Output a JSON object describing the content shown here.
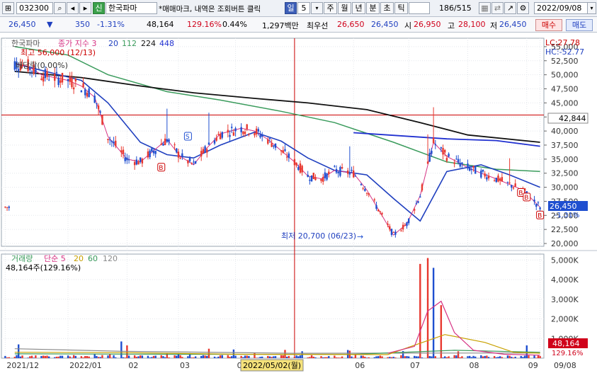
{
  "toolbar": {
    "code": "032300",
    "name_badge": "신",
    "name": "한국파마",
    "marquee": "*매매마크, 내역은 조회버튼 클릭",
    "period_unit": "일",
    "period_value": "5",
    "periods": [
      "주",
      "월",
      "년",
      "분",
      "초",
      "틱"
    ],
    "bars_count": "186/515",
    "date": "2022/09/08",
    "count_value": "350"
  },
  "quote": {
    "price": "26,450",
    "arrow": "▼",
    "change": "350",
    "change_pct": "-1.31%",
    "volume": "48,164",
    "volume_pct": "129.16%",
    "turnover_pct": "0.44%",
    "amount": "1,297백만",
    "best_ask_label": "최우선",
    "best_ask": "26,650",
    "best_bid": "26,450",
    "open_label": "시",
    "open": "26,950",
    "high_label": "고",
    "high": "28,100",
    "low_label": "저",
    "low": "26,450",
    "buy_label": "매수",
    "sell_label": "매도"
  },
  "colors": {
    "up": "#e8382f",
    "down": "#1f4fd0",
    "ma3": "#d63384",
    "ma20": "#1f3fbf",
    "ma112": "#3a9b5c",
    "ma224": "#111111",
    "ma448": "#2030d0",
    "accent_red": "#cc0000"
  },
  "chart_data": [
    {
      "type": "candlestick",
      "title": "한국파마",
      "legend": [
        {
          "label": "종가 지수 3",
          "color": "#d63384"
        },
        {
          "label": "20",
          "color": "#1f3fbf"
        },
        {
          "label": "112",
          "color": "#3a9b5c"
        },
        {
          "label": "224",
          "color": "#111111"
        },
        {
          "label": "448",
          "color": "#2030d0"
        }
      ],
      "annotations": {
        "high": "최고 56,000 (12/13)",
        "low": "최저 20,700 (06/23)",
        "pattern": "배당락(0.00%)",
        "lc": "LC:27.78",
        "hc": "HC:-52.77",
        "marker_price": "42,844",
        "cursor_date": "2022/05/02(월)",
        "last_price_tag": "26,450",
        "last_pct_tag": "-1.31%",
        "trade_marks": [
          "S",
          "B",
          "B",
          "B",
          "B"
        ]
      },
      "ylim": [
        19500,
        56500
      ],
      "y_ticks": [
        20000,
        22500,
        25000,
        27500,
        30000,
        32500,
        35000,
        37500,
        40000,
        42500,
        45000,
        47500,
        50000,
        52500,
        55000
      ],
      "y_tick_labels": [
        "20,000",
        "22,500",
        "25,000",
        "27,500",
        "30,000",
        "32,500",
        "35,000",
        "37,500",
        "40,000",
        "42,500",
        "45,000",
        "47,500",
        "50,000",
        "52,500",
        "55,000"
      ],
      "x_labels": [
        "2021/12",
        "2022/01",
        "02",
        "03",
        "04",
        "05",
        "06",
        "07",
        "08",
        "09",
        "09/08"
      ],
      "close_trend": [
        [
          "2021-12-06",
          52000
        ],
        [
          "2021-12-13",
          51500
        ],
        [
          "2021-12-20",
          50000
        ],
        [
          "2021-12-27",
          49500
        ],
        [
          "2022-01-03",
          49000
        ],
        [
          "2022-01-10",
          48000
        ],
        [
          "2022-01-17",
          46000
        ],
        [
          "2022-01-24",
          39000
        ],
        [
          "2022-02-03",
          35000
        ],
        [
          "2022-02-10",
          34500
        ],
        [
          "2022-02-17",
          36500
        ],
        [
          "2022-02-24",
          38500
        ],
        [
          "2022-03-03",
          35500
        ],
        [
          "2022-03-10",
          34000
        ],
        [
          "2022-03-17",
          37000
        ],
        [
          "2022-03-24",
          39500
        ],
        [
          "2022-04-04",
          40500
        ],
        [
          "2022-04-11",
          40000
        ],
        [
          "2022-04-18",
          38500
        ],
        [
          "2022-04-25",
          36500
        ],
        [
          "2022-05-02",
          34500
        ],
        [
          "2022-05-09",
          32000
        ],
        [
          "2022-05-16",
          31500
        ],
        [
          "2022-05-23",
          33000
        ],
        [
          "2022-06-02",
          32500
        ],
        [
          "2022-06-09",
          29500
        ],
        [
          "2022-06-16",
          25500
        ],
        [
          "2022-06-23",
          21500
        ],
        [
          "2022-06-30",
          23500
        ],
        [
          "2022-07-07",
          28500
        ],
        [
          "2022-07-14",
          38000
        ],
        [
          "2022-07-21",
          35500
        ],
        [
          "2022-08-01",
          33500
        ],
        [
          "2022-08-08",
          32500
        ],
        [
          "2022-08-16",
          31500
        ],
        [
          "2022-08-23",
          30500
        ],
        [
          "2022-08-30",
          29500
        ],
        [
          "2022-09-08",
          26450
        ]
      ],
      "ma20": [
        [
          "2021-12-06",
          52000
        ],
        [
          "2022-01-10",
          49000
        ],
        [
          "2022-01-24",
          45000
        ],
        [
          "2022-02-10",
          38000
        ],
        [
          "2022-02-24",
          35800
        ],
        [
          "2022-03-10",
          35200
        ],
        [
          "2022-03-24",
          37500
        ],
        [
          "2022-04-11",
          39800
        ],
        [
          "2022-04-25",
          38200
        ],
        [
          "2022-05-09",
          35200
        ],
        [
          "2022-05-23",
          33000
        ],
        [
          "2022-06-09",
          32200
        ],
        [
          "2022-06-23",
          28000
        ],
        [
          "2022-07-07",
          24000
        ],
        [
          "2022-07-21",
          32800
        ],
        [
          "2022-08-08",
          34000
        ],
        [
          "2022-08-23",
          32200
        ],
        [
          "2022-09-08",
          30000
        ]
      ],
      "ma112": [
        [
          "2021-12-06",
          55000
        ],
        [
          "2022-01-03",
          53500
        ],
        [
          "2022-01-24",
          50000
        ],
        [
          "2022-02-24",
          47000
        ],
        [
          "2022-03-24",
          45500
        ],
        [
          "2022-04-25",
          43500
        ],
        [
          "2022-05-23",
          41500
        ],
        [
          "2022-06-23",
          38000
        ],
        [
          "2022-07-21",
          34500
        ],
        [
          "2022-08-16",
          33200
        ],
        [
          "2022-09-08",
          32800
        ]
      ],
      "ma224": [
        [
          "2021-12-06",
          50600
        ],
        [
          "2022-01-10",
          49500
        ],
        [
          "2022-02-10",
          48000
        ],
        [
          "2022-03-10",
          46800
        ],
        [
          "2022-04-11",
          45800
        ],
        [
          "2022-05-09",
          45000
        ],
        [
          "2022-06-09",
          43800
        ],
        [
          "2022-07-07",
          41500
        ],
        [
          "2022-08-01",
          39300
        ],
        [
          "2022-09-08",
          38000
        ]
      ],
      "ma448": [
        [
          "2022-06-02",
          39700
        ],
        [
          "2022-07-21",
          38600
        ],
        [
          "2022-08-16",
          38300
        ],
        [
          "2022-09-08",
          37300
        ]
      ]
    },
    {
      "type": "bar",
      "title": "거래량",
      "legend": [
        {
          "label": "단순 5",
          "color": "#d63384"
        },
        {
          "label": "20",
          "color": "#c8a000"
        },
        {
          "label": "60",
          "color": "#3a9b5c"
        },
        {
          "label": "120",
          "color": "#8a8a8a"
        }
      ],
      "info": "48,164주(129.16%)",
      "ylim": [
        0,
        5300
      ],
      "y_ticks": [
        1000,
        2000,
        3000,
        4000,
        5000
      ],
      "y_tick_labels": [
        "1,000K",
        "2,000K",
        "3,000K",
        "4,000K",
        "5,000K"
      ],
      "last_volume_tag": "48,164",
      "last_pct_tag": "129.16%",
      "spikes_k": [
        [
          "2021-12-08",
          700
        ],
        [
          "2022-01-31",
          850
        ],
        [
          "2022-02-03",
          650
        ],
        [
          "2022-03-18",
          480
        ],
        [
          "2022-04-27",
          420
        ],
        [
          "2022-05-31",
          380
        ],
        [
          "2022-07-07",
          4800
        ],
        [
          "2022-07-11",
          5100
        ],
        [
          "2022-07-14",
          4600
        ],
        [
          "2022-07-18",
          2700
        ],
        [
          "2022-09-01",
          650
        ]
      ]
    }
  ]
}
